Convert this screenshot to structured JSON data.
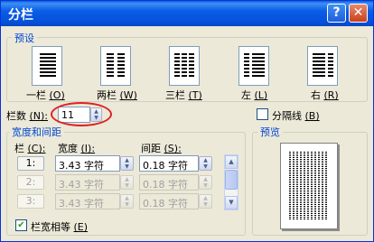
{
  "window": {
    "title": "分栏",
    "help_label": "?",
    "close_label": "✕"
  },
  "presets": {
    "group_label": "预设",
    "items": [
      {
        "label": "一栏",
        "hotkey": "(O)",
        "icon": "one-column-icon"
      },
      {
        "label": "两栏",
        "hotkey": "(W)",
        "icon": "two-column-icon"
      },
      {
        "label": "三栏",
        "hotkey": "(T)",
        "icon": "three-column-icon"
      },
      {
        "label": "左",
        "hotkey": "(L)",
        "icon": "left-column-icon"
      },
      {
        "label": "右",
        "hotkey": "(R)",
        "icon": "right-column-icon"
      }
    ]
  },
  "column_count": {
    "label": "栏数",
    "hotkey": "(N):",
    "value": "11",
    "highlight_color": "#e02020"
  },
  "separator": {
    "label": "分隔线",
    "hotkey": "(B)",
    "checked": false
  },
  "width_spacing": {
    "group_label": "宽度和间距",
    "headers": {
      "col": "栏",
      "col_key": "(C):",
      "width": "宽度",
      "width_key": "(I):",
      "spacing": "间距",
      "spacing_key": "(S):"
    },
    "rows": [
      {
        "col": "1:",
        "width": "3.43 字符",
        "spacing": "0.18 字符"
      },
      {
        "col": "2:",
        "width": "3.43 字符",
        "spacing": "0.18 字符"
      },
      {
        "col": "3:",
        "width": "3.43 字符",
        "spacing": "0.18 字符"
      }
    ]
  },
  "equal_width": {
    "label": "栏宽相等",
    "hotkey": "(E)",
    "checked": true
  },
  "preview": {
    "label": "预览"
  },
  "icons": {
    "spin_up": "▲",
    "spin_down": "▼",
    "check_mark": "✔"
  }
}
